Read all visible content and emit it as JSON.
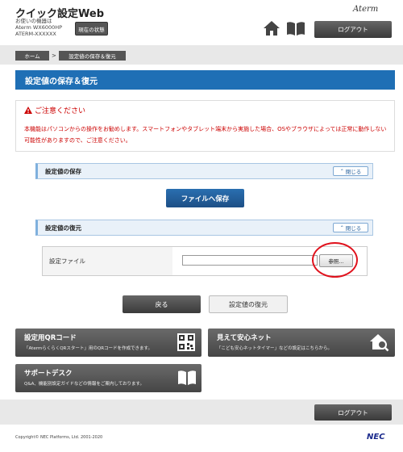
{
  "header": {
    "app_title": "クイック設定Web",
    "device_label": "お使いの機器は",
    "device_model": "Aterm WX6000HP",
    "device_id": "ATERM-XXXXXX",
    "status_button": "現在の状態",
    "brand": "Aterm",
    "home_icon": "home-icon",
    "manual_icon": "book-icon",
    "logout_label": "ログアウト"
  },
  "breadcrumb": {
    "home": "ホーム",
    "separator": ">",
    "current": "設定値の保存＆復元"
  },
  "page_title": "設定値の保存＆復元",
  "caution": {
    "heading": "ご注意ください",
    "text": "本機能はパソコンからの操作をお勧めします。スマートフォンやタブレット端末から実施した場合、OSやブラウザによっては正常に動作しない可能性がありますので、ご注意ください。"
  },
  "save_section": {
    "title": "設定値の保存",
    "collapse_label": "閉じる",
    "save_button": "ファイルへ保存"
  },
  "restore_section": {
    "title": "設定値の復元",
    "collapse_label": "閉じる",
    "file_label": "設定ファイル",
    "file_value": "",
    "browse_button": "参照..."
  },
  "actions": {
    "back": "戻る",
    "restore": "設定値の復元"
  },
  "cards": {
    "qr": {
      "title": "設定用QRコード",
      "desc": "「AtermらくらくQRスタート」用のQRコードを作成できます。",
      "icon": "qr-code-icon"
    },
    "safety": {
      "title": "見えて安心ネット",
      "desc": "「こども安心ネットタイマー」などの設定はこちらから。",
      "icon": "home-search-icon"
    },
    "support": {
      "title": "サポートデスク",
      "desc": "Q&A、機能別設定ガイドなどの情報をご案内しております。",
      "icon": "book-icon"
    }
  },
  "footer": {
    "logout_label": "ログアウト",
    "copyright": "Copyright© NEC Platforms, Ltd. 2001-2020",
    "logo": "NEC"
  },
  "colors": {
    "title_bar": "#1f6fb5",
    "caution": "#cc0000",
    "highlight": "#e0121d"
  }
}
